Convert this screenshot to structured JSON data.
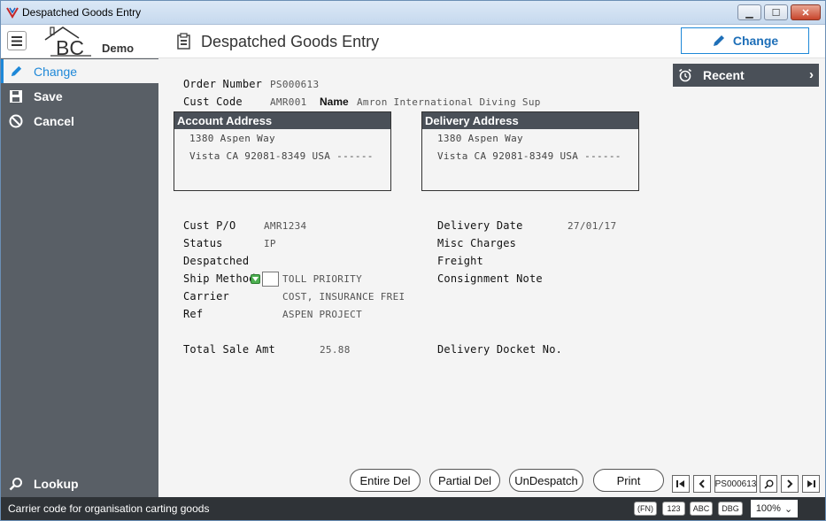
{
  "window": {
    "title": "Despatched Goods Entry",
    "min": "▁",
    "max": "☐",
    "close": "✕"
  },
  "header": {
    "logo_text": "BC",
    "logo_demo": "Demo",
    "page_title": "Despatched Goods Entry",
    "change_label": "Change"
  },
  "sidebar": {
    "change": "Change",
    "save": "Save",
    "cancel": "Cancel",
    "lookup": "Lookup"
  },
  "order": {
    "order_number_label": "Order Number",
    "order_number": "PS000613",
    "cust_code_label": "Cust Code",
    "cust_code": "AMR001",
    "name_label": "Name",
    "name": "Amron International Diving Sup"
  },
  "account_address": {
    "title": "Account Address",
    "line1": "1380 Aspen Way",
    "line2": "Vista CA 92081-8349 USA ------"
  },
  "delivery_address": {
    "title": "Delivery Address",
    "line1": "1380 Aspen Way",
    "line2": "Vista CA 92081-8349 USA ------"
  },
  "details": {
    "cust_po_label": "Cust P/O",
    "cust_po": "AMR1234",
    "status_label": "Status",
    "status": "IP",
    "despatched_label": "Despatched",
    "ship_method_label": "Ship Method",
    "ship_method": "TOLL PRIORITY",
    "carrier_label": "Carrier",
    "carrier": "COST, INSURANCE FREI",
    "ref_label": "Ref",
    "ref": "ASPEN PROJECT",
    "total_label": "Total Sale Amt",
    "total": "25.88",
    "delivery_date_label": "Delivery Date",
    "delivery_date": "27/01/17",
    "misc_label": "Misc Charges",
    "freight_label": "Freight",
    "consignment_label": "Consignment Note",
    "docket_label": "Delivery Docket No."
  },
  "recent": {
    "label": "Recent"
  },
  "buttons": {
    "entire_del": "Entire Del",
    "partial_del": "Partial Del",
    "undespatch": "UnDespatch",
    "print": "Print"
  },
  "nav": {
    "record": "PS000613"
  },
  "status": {
    "message": "Carrier code for organisation carting goods",
    "fn": "(FN)",
    "num": "123",
    "abc": "ABC",
    "dbg": "DBG",
    "zoom": "100%"
  },
  "colors": {
    "accent": "#1e88d8",
    "sidebar": "#595f66",
    "panel_header": "#4a5058",
    "statusbar": "#2f3337"
  }
}
